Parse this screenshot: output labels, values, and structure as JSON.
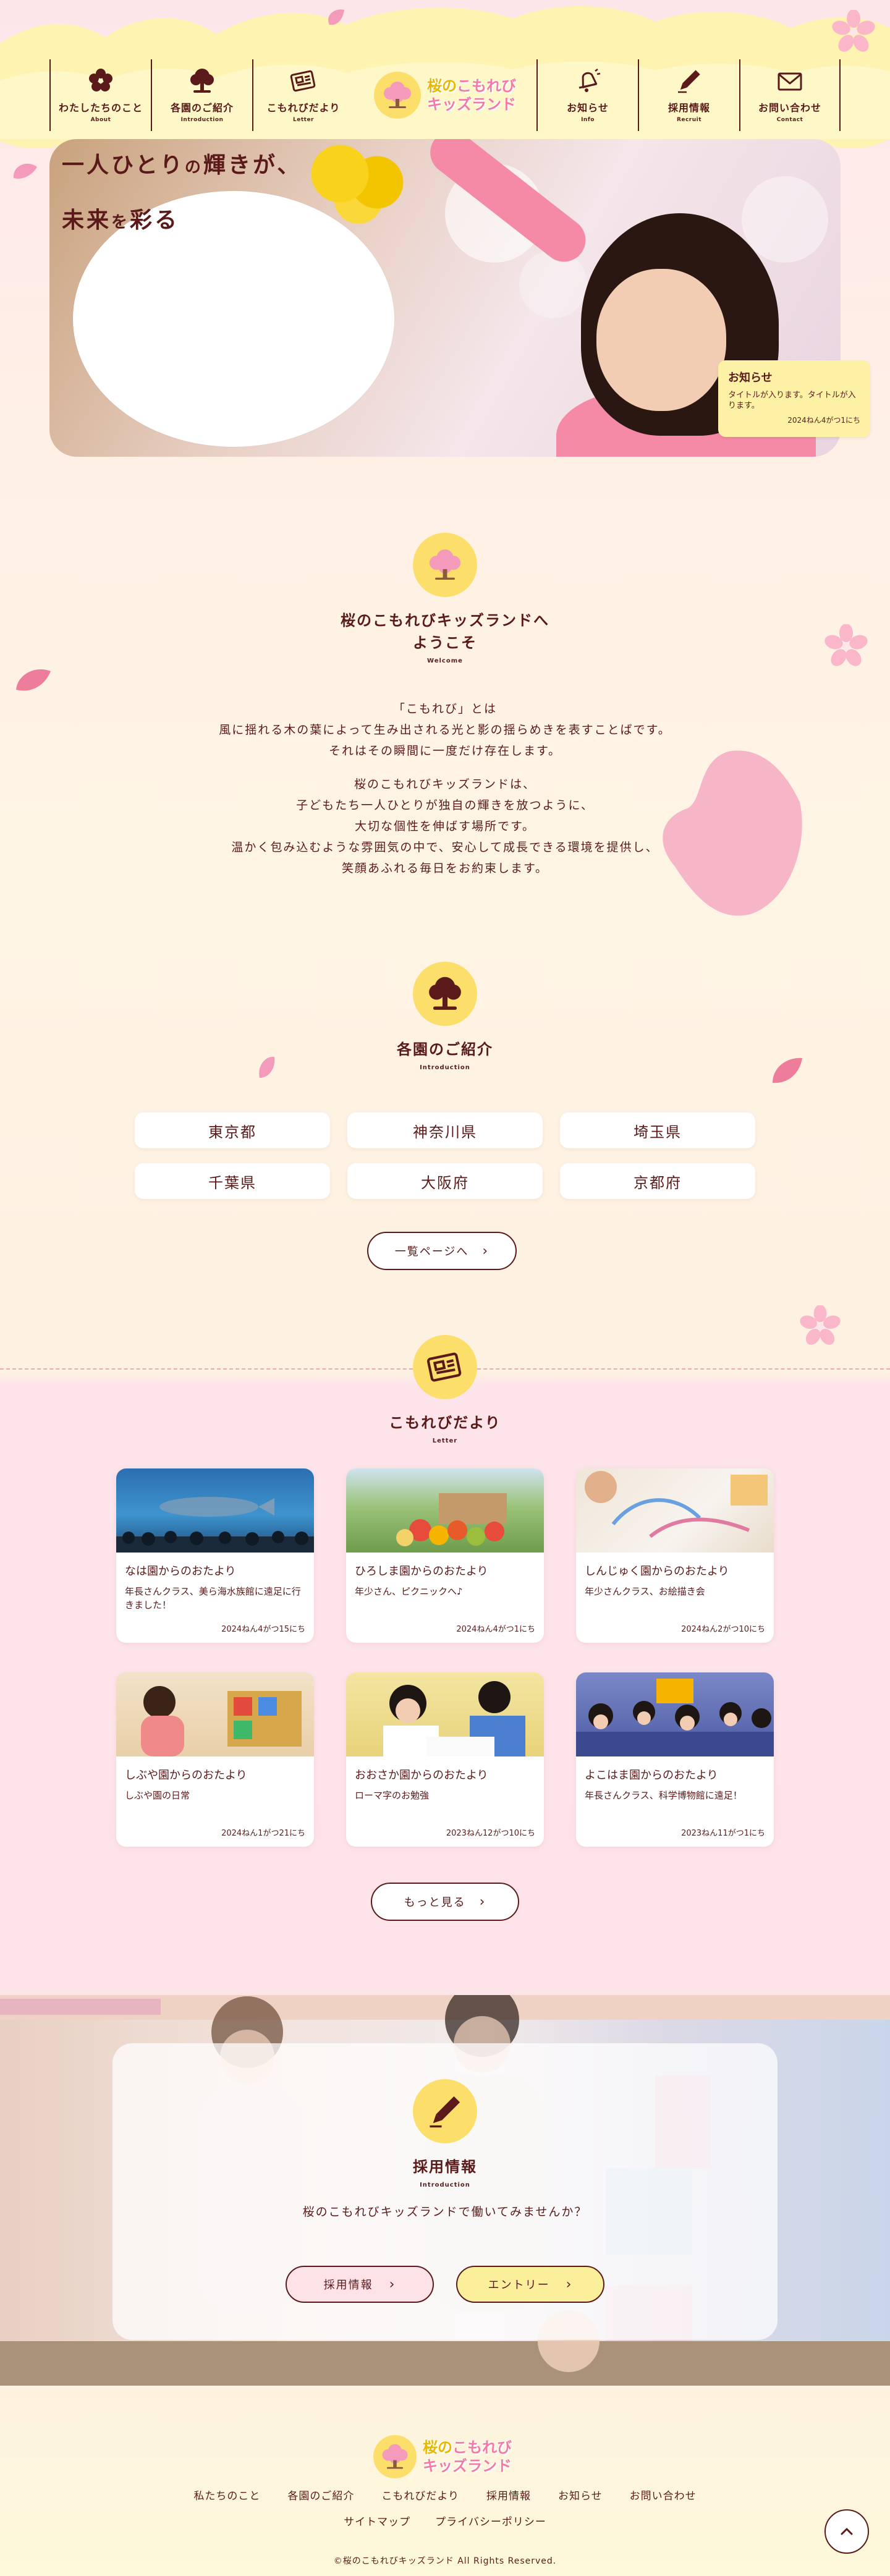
{
  "header": {
    "nav": [
      {
        "label": "わたしたちのこと",
        "sub": "About",
        "icon": "sakura-flower-icon"
      },
      {
        "label": "各園のご紹介",
        "sub": "Introduction",
        "icon": "tree-icon"
      },
      {
        "label": "こもれびだより",
        "sub": "Letter",
        "icon": "newspaper-icon"
      },
      {
        "label": "お知らせ",
        "sub": "Info",
        "icon": "bell-icon"
      },
      {
        "label": "採用情報",
        "sub": "Recruit",
        "icon": "pen-icon"
      },
      {
        "label": "お問い合わせ",
        "sub": "Contact",
        "icon": "mail-icon"
      }
    ],
    "logo": {
      "line1_a": "桜の",
      "line1_b": "こもれび",
      "line2": "キッズランド"
    }
  },
  "hero": {
    "copy_line1_a": "一人ひとり",
    "copy_line1_b": "の",
    "copy_line1_c": "輝きが、",
    "copy_line2_a": "未来",
    "copy_line2_b": "を",
    "copy_line2_c": "彩る"
  },
  "news_card": {
    "title": "お知らせ",
    "body": "タイトルが入ります。タイトルが入ります。",
    "date": "2024ねん4がつ1にち"
  },
  "welcome": {
    "title_line1": "桜のこもれびキッズランドへ",
    "title_line2": "ようこそ",
    "sub": "Welcome",
    "paragraphs": [
      [
        "「こもれび」とは",
        "風に揺れる木の葉によって生み出される光と影の揺らめきを表すことばです。",
        "それはその瞬間に一度だけ存在します。"
      ],
      [
        "桜のこもれびキッズランドは、",
        "子どもたち一人ひとりが独自の輝きを放つように、",
        "大切な個性を伸ばす場所です。",
        "温かく包み込むような雰囲気の中で、安心して成長できる環境を提供し、",
        "笑顔あふれる毎日をお約束します。"
      ]
    ]
  },
  "introduction": {
    "title": "各園のご紹介",
    "sub": "Introduction",
    "prefectures": [
      "東京都",
      "神奈川県",
      "埼玉県",
      "千葉県",
      "大阪府",
      "京都府"
    ],
    "list_button": "一覧ページへ"
  },
  "letters": {
    "title": "こもれびだより",
    "sub": "Letter",
    "cards": [
      {
        "title": "なは園からのおたより",
        "desc": "年長さんクラス、美ら海水族館に遠足に行きました！",
        "date": "2024ねん4がつ15にち",
        "img": "aquarium"
      },
      {
        "title": "ひろしま園からのおたより",
        "desc": "年少さん、ピクニックへ♪",
        "date": "2024ねん4がつ1にち",
        "img": "picnic"
      },
      {
        "title": "しんじゅく園からのおたより",
        "desc": "年少さんクラス、お絵描き会",
        "date": "2024ねん2がつ10にち",
        "img": "drawing"
      },
      {
        "title": "しぶや園からのおたより",
        "desc": "しぶや園の日常",
        "date": "2024ねん1がつ21にち",
        "img": "daily"
      },
      {
        "title": "おおさか園からのおたより",
        "desc": "ローマ字のお勉強",
        "date": "2023ねん12がつ10にち",
        "img": "study"
      },
      {
        "title": "よこはま園からのおたより",
        "desc": "年長さんクラス、科学博物館に遠足！",
        "date": "2023ねん11がつ1にち",
        "img": "museum"
      }
    ],
    "more_button": "もっと見る"
  },
  "recruit": {
    "title": "採用情報",
    "sub": "Introduction",
    "lead": "桜のこもれびキッズランドで働いてみませんか？",
    "btn_info": "採用情報",
    "btn_entry": "エントリー"
  },
  "footer": {
    "nav": [
      "私たちのこと",
      "各園のご紹介",
      "こもれびだより",
      "採用情報",
      "お知らせ",
      "お問い合わせ"
    ],
    "nav2": [
      "サイトマップ",
      "プライバシーポリシー"
    ],
    "copyright": "©桜のこもれびキッズランド All Rights Reserved."
  },
  "colors": {
    "text": "#5a1a1a",
    "yellow": "#fcdf6a",
    "pink": "#f27aa3",
    "bg_pink": "#fde6ea",
    "bg_cream": "#fef4e4"
  }
}
